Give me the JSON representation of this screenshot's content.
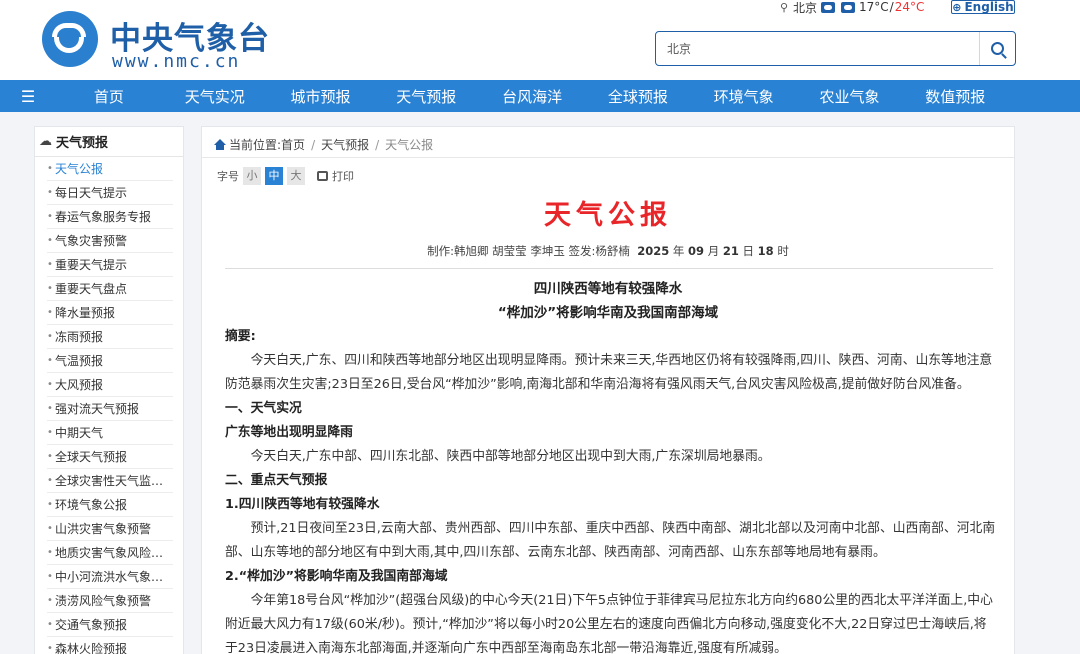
{
  "header": {
    "logo_cn": "中央气象台",
    "logo_en": "www.nmc.cn",
    "location": "北京",
    "temp_low": "17°C",
    "temp_sep": "/",
    "temp_high": "24°C",
    "lang_label": "English",
    "search": {
      "value": "北京"
    }
  },
  "nav": {
    "items": [
      "首页",
      "天气实况",
      "城市预报",
      "天气预报",
      "台风海洋",
      "全球预报",
      "环境气象",
      "农业气象",
      "数值预报"
    ]
  },
  "sidebar": {
    "title": "天气预报",
    "items": [
      "天气公报",
      "每日天气提示",
      "春运气象服务专报",
      "气象灾害预警",
      "重要天气提示",
      "重要天气盘点",
      "降水量预报",
      "冻雨预报",
      "气温预报",
      "大风预报",
      "强对流天气预报",
      "中期天气",
      "全球天气预报",
      "全球灾害性天气监测...",
      "环境气象公报",
      "山洪灾害气象预警",
      "地质灾害气象风险预警",
      "中小河流洪水气象风...",
      "渍涝风险气象预警",
      "交通气象预报",
      "森林火险预报"
    ]
  },
  "breadcrumb": {
    "label": "当前位置:",
    "items": [
      "首页",
      "天气预报",
      "天气公报"
    ]
  },
  "fontbar": {
    "label": "字号",
    "small": "小",
    "medium": "中",
    "large": "大",
    "print": "打印"
  },
  "doc": {
    "title": "天气公报",
    "meta_prefix": "制作:韩旭卿 胡莹莹 李坤玉 签发:杨舒楠",
    "year": "2025",
    "year_unit": "年",
    "month": "09",
    "month_unit": "月",
    "day": "21",
    "day_unit": "日",
    "hour": "18",
    "hour_unit": "时",
    "headline1": "四川陕西等地有较强降水",
    "headline2": "“桦加沙”将影响华南及我国南部海域",
    "summary_label": "摘要:",
    "summary": "今天白天,广东、四川和陕西等地部分地区出现明显降雨。预计未来三天,华西地区仍将有较强降雨,四川、陕西、河南、山东等地注意防范暴雨次生灾害;23日至26日,受台风“桦加沙”影响,南海北部和华南沿海将有强风雨天气,台风灾害风险极高,提前做好防台风准备。",
    "sec1": "一、天气实况",
    "sec1_sub": "广东等地出现明显降雨",
    "sec1_text": "今天白天,广东中部、四川东北部、陕西中部等地部分地区出现中到大雨,广东深圳局地暴雨。",
    "sec2": "二、重点天气预报",
    "sec2_sub1": "1.四川陕西等地有较强降水",
    "sec2_text1": "预计,21日夜间至23日,云南大部、贵州西部、四川中东部、重庆中西部、陕西中南部、湖北北部以及河南中北部、山西南部、河北南部、山东等地的部分地区有中到大雨,其中,四川东部、云南东北部、陕西南部、河南西部、山东东部等地局地有暴雨。",
    "sec2_sub2": "2.“桦加沙”将影响华南及我国南部海域",
    "sec2_text2": "今年第18号台风“桦加沙”(超强台风级)的中心今天(21日)下午5点钟位于菲律宾马尼拉东北方向约680公里的西北太平洋洋面上,中心附近最大风力有17级(60米/秒)。预计,“桦加沙”将以每小时20公里左右的速度向西偏北方向移动,强度变化不大,22日穿过巴士海峡后,将于23日凌晨进入南海东北部海面,并逐渐向广东中西部至海南岛东北部一带沿海靠近,强度有所减弱。"
  },
  "colors": {
    "brand_blue": "#1f5fa8",
    "nav_blue": "#2a82d4",
    "title_red": "#e8262a",
    "temp_high": "#e33"
  }
}
